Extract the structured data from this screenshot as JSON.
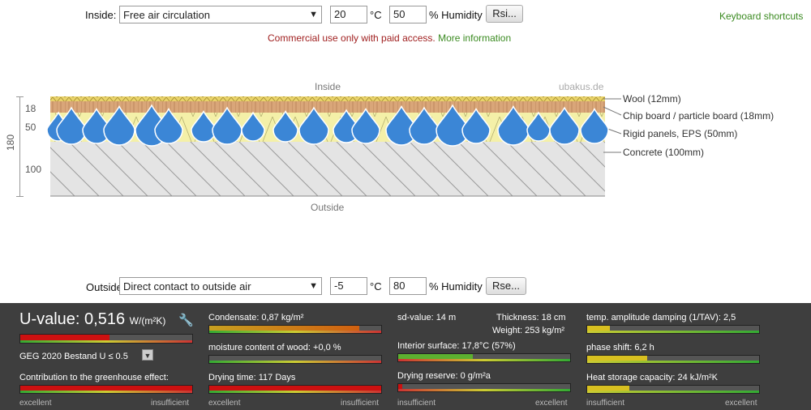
{
  "inside_controls": {
    "label": "Inside:",
    "select_value": "Free air circulation",
    "temperature": "20",
    "temp_unit": "°C",
    "humidity": "50",
    "humidity_unit": "% Humidity",
    "button": "Rsi..."
  },
  "keyboard_shortcuts": "Keyboard shortcuts",
  "notice": {
    "text": "Commercial use only with paid access.",
    "link": "More information"
  },
  "diagram": {
    "inside_label": "Inside",
    "outside_label": "Outside",
    "brand": "ubakus.de",
    "total_thickness": "180",
    "thickness_labels": [
      "18",
      "50",
      "100"
    ],
    "layers": [
      {
        "name": "Wool (12mm)",
        "color": "#e9d36a"
      },
      {
        "name": "Chip board / particle board (18mm)",
        "color": "#d9a679"
      },
      {
        "name": "Rigid panels, EPS (50mm)",
        "color": "#f4f0a8"
      },
      {
        "name": "Concrete (100mm)",
        "color": "#e4e4e4"
      }
    ],
    "drop_color": "#3b86d6"
  },
  "outside_controls": {
    "label": "Outside",
    "select_value": "Direct contact to outside air",
    "temperature": "-5",
    "temp_unit": "°C",
    "humidity": "80",
    "humidity_unit": "% Humidity",
    "button": "Rse..."
  },
  "results": {
    "u_value_label": "U-value:",
    "u_value": "0,516",
    "u_unit": "W/(m²K)",
    "standard": "GEG 2020 Bestand U ≤ 0.5",
    "greenhouse": "Contribution to the greenhouse effect:",
    "condensate": "Condensate: 0,87 kg/m²",
    "moisture": "moisture content of wood: +0,0 %",
    "drying_time": "Drying time: 117 Days",
    "sd_value": "sd-value: 14 m",
    "thickness": "Thickness: 18 cm",
    "weight": "Weight: 253 kg/m²",
    "interior_surface": "Interior surface: 17,8°C (57%)",
    "drying_reserve": "Drying reserve: 0 g/m²a",
    "temp_damping": "temp. amplitude damping (1/TAV): 2,5",
    "phase_shift": "phase shift: 6,2 h",
    "heat_storage": "Heat storage capacity: 24 kJ/m²K",
    "scale_excellent": "excellent",
    "scale_insufficient": "insufficient"
  }
}
